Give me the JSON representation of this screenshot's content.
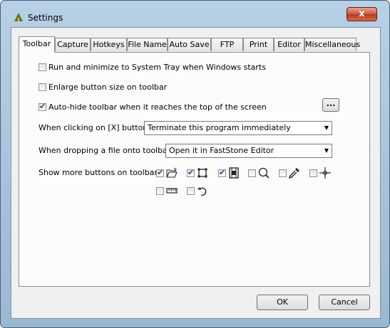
{
  "window": {
    "title": "Settings",
    "close_label": "x"
  },
  "tabs": [
    {
      "label": "Toolbar",
      "active": true
    },
    {
      "label": "Capture"
    },
    {
      "label": "Hotkeys"
    },
    {
      "label": "File Name"
    },
    {
      "label": "Auto Save"
    },
    {
      "label": "FTP"
    },
    {
      "label": "Print"
    },
    {
      "label": "Editor"
    },
    {
      "label": "Miscellaneous"
    }
  ],
  "options": {
    "run_minimize": {
      "label": "Run and minimize to System Tray when Windows starts",
      "checked": false
    },
    "enlarge_buttons": {
      "label": "Enlarge button size on toolbar",
      "checked": false
    },
    "auto_hide": {
      "label": "Auto-hide toolbar when it reaches the top of the screen",
      "checked": true
    }
  },
  "more_button": {
    "label": "..."
  },
  "close_action": {
    "label": "When clicking on [X] button :",
    "value": "Terminate this program immediately"
  },
  "drop_action": {
    "label": "When dropping a file onto toolbar :",
    "value": "Open it in FastStone Editor"
  },
  "more_buttons": {
    "label": "Show more buttons on toolbar :",
    "items": [
      {
        "icon": "open-folder-icon",
        "checked": true
      },
      {
        "icon": "crop-icon",
        "checked": true
      },
      {
        "icon": "filmstrip-icon",
        "checked": true
      },
      {
        "icon": "magnifier-icon",
        "checked": false
      },
      {
        "icon": "color-picker-icon",
        "checked": false
      },
      {
        "icon": "crosshair-icon",
        "checked": false
      },
      {
        "icon": "ruler-icon",
        "checked": false
      },
      {
        "icon": "undo-arrow-icon",
        "checked": false
      }
    ]
  },
  "buttons": {
    "ok": "OK",
    "cancel": "Cancel"
  }
}
